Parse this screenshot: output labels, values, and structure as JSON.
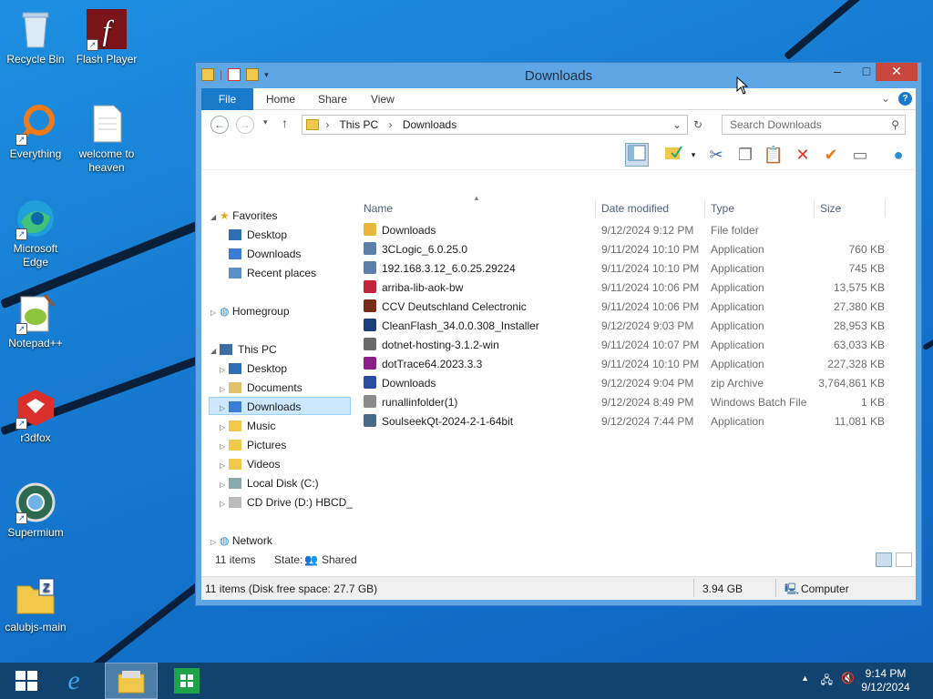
{
  "desktop": {
    "icons": [
      {
        "label": "Recycle Bin",
        "icon": "recycle-bin-icon"
      },
      {
        "label": "Flash Player",
        "icon": "flash-player-icon"
      },
      {
        "label": "Everything",
        "icon": "everything-icon"
      },
      {
        "label": "welcome to heaven",
        "icon": "text-document-icon"
      },
      {
        "label": "Microsoft Edge",
        "icon": "edge-icon"
      },
      {
        "label": "Notepad++",
        "icon": "notepadpp-icon"
      },
      {
        "label": "r3dfox",
        "icon": "r3dfox-icon"
      },
      {
        "label": "Supermium",
        "icon": "supermium-icon"
      },
      {
        "label": "calubjs-main",
        "icon": "zip-folder-icon"
      }
    ]
  },
  "window": {
    "title": "Downloads",
    "ribbon_tabs": [
      "File",
      "Home",
      "Share",
      "View"
    ],
    "address": {
      "segments": [
        "This PC",
        "Downloads"
      ]
    },
    "search_placeholder": "Search Downloads",
    "nav": {
      "favorites": "Favorites",
      "fav_items": [
        "Desktop",
        "Downloads",
        "Recent places"
      ],
      "homegroup": "Homegroup",
      "this_pc": "This PC",
      "pc_items": [
        "Desktop",
        "Documents",
        "Downloads",
        "Music",
        "Pictures",
        "Videos",
        "Local Disk (C:)",
        "CD Drive (D:) HBCD_"
      ],
      "network": "Network"
    },
    "columns": {
      "name": "Name",
      "date": "Date modified",
      "type": "Type",
      "size": "Size"
    },
    "files": [
      {
        "name": "Downloads",
        "date": "9/12/2024 9:12 PM",
        "type": "File folder",
        "size": "",
        "color": "#e8b83a"
      },
      {
        "name": "3CLogic_6.0.25.0",
        "date": "9/11/2024 10:10 PM",
        "type": "Application",
        "size": "760 KB",
        "color": "#5b7fa8"
      },
      {
        "name": "192.168.3.12_6.0.25.29224",
        "date": "9/11/2024 10:10 PM",
        "type": "Application",
        "size": "745 KB",
        "color": "#5b7fa8"
      },
      {
        "name": "arriba-lib-aok-bw",
        "date": "9/11/2024 10:06 PM",
        "type": "Application",
        "size": "13,575 KB",
        "color": "#c0243a"
      },
      {
        "name": "CCV Deutschland Celectronic",
        "date": "9/11/2024 10:06 PM",
        "type": "Application",
        "size": "27,380 KB",
        "color": "#7a2a1a"
      },
      {
        "name": "CleanFlash_34.0.0.308_Installer",
        "date": "9/12/2024 9:03 PM",
        "type": "Application",
        "size": "28,953 KB",
        "color": "#1a3f7a"
      },
      {
        "name": "dotnet-hosting-3.1.2-win",
        "date": "9/11/2024 10:07 PM",
        "type": "Application",
        "size": "63,033 KB",
        "color": "#6a6a6a"
      },
      {
        "name": "dotTrace64.2023.3.3",
        "date": "9/11/2024 10:10 PM",
        "type": "Application",
        "size": "227,328 KB",
        "color": "#8a1f8a"
      },
      {
        "name": "Downloads",
        "date": "9/12/2024 9:04 PM",
        "type": "zip Archive",
        "size": "3,764,861 KB",
        "color": "#2a4fa0"
      },
      {
        "name": "runallinfolder(1)",
        "date": "9/12/2024 8:49 PM",
        "type": "Windows Batch File",
        "size": "1 KB",
        "color": "#8a8a8a"
      },
      {
        "name": "SoulseekQt-2024-2-1-64bit",
        "date": "9/12/2024 7:44 PM",
        "type": "Application",
        "size": "11,081 KB",
        "color": "#4a6a8a"
      }
    ],
    "status": {
      "count": "11 items",
      "state_label": "State:",
      "state_value": "Shared"
    },
    "details": {
      "left": "11 items (Disk free space: 27.7 GB)",
      "size": "3.94 GB",
      "location": "Computer"
    }
  },
  "taskbar": {
    "time": "9:14 PM",
    "date": "9/12/2024"
  }
}
